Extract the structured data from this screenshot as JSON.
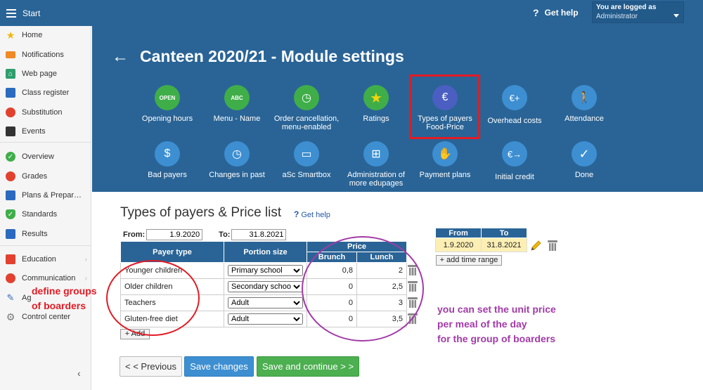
{
  "topbar": {
    "start_label": "Start",
    "help_label": "Get help",
    "user_line1": "You are logged as",
    "user_line2": "Administrator"
  },
  "sidebar": {
    "items": [
      {
        "label": "Home",
        "icon": "star-icon",
        "color": "#f2b705"
      },
      {
        "label": "Notifications",
        "icon": "envelope-icon",
        "color": "#f08a24"
      },
      {
        "label": "Web page",
        "icon": "house-icon",
        "color": "#2e9e6b"
      },
      {
        "label": "Class register",
        "icon": "register-icon",
        "color": "#2a6bbf"
      },
      {
        "label": "Substitution",
        "icon": "person-icon",
        "color": "#e2412f"
      },
      {
        "label": "Events",
        "icon": "calendar-icon",
        "color": "#333333"
      },
      {
        "label": "Overview",
        "icon": "check-circle-icon",
        "color": "#3fae49"
      },
      {
        "label": "Grades",
        "icon": "grades-icon",
        "color": "#e2412f"
      },
      {
        "label": "Plans & Prepar…",
        "icon": "briefcase-icon",
        "color": "#2a6bbf"
      },
      {
        "label": "Standards",
        "icon": "shield-icon",
        "color": "#3fae49"
      },
      {
        "label": "Results",
        "icon": "bar-chart-icon",
        "color": "#2a6bbf"
      },
      {
        "label": "Education",
        "icon": "book-icon",
        "color": "#e2412f"
      },
      {
        "label": "Communication",
        "icon": "chat-icon",
        "color": "#e2412f"
      },
      {
        "label": "Ag",
        "icon": "pen-icon",
        "color": "#2a6bbf"
      },
      {
        "label": "Control center",
        "icon": "gear-icon",
        "color": "#777777"
      }
    ]
  },
  "header": {
    "title": "Canteen 2020/21 - Module settings",
    "tiles": [
      {
        "label": "Opening hours",
        "icon": "open-sign-icon",
        "color": "#3fae49"
      },
      {
        "label": "Menu - Name",
        "icon": "abc-123-icon",
        "color": "#3fae49"
      },
      {
        "label": "Order cancellation, menu-enabled",
        "icon": "clock-icon",
        "color": "#3fae49"
      },
      {
        "label": "Ratings",
        "icon": "star-icon",
        "color": "#3fae49"
      },
      {
        "label": "Types of payers Food-Price",
        "icon": "payer-icon",
        "color": "#4a5fc1"
      },
      {
        "label": "Overhead costs",
        "icon": "euro-plus-icon",
        "color": "#3d8fd1"
      },
      {
        "label": "Attendance",
        "icon": "walking-person-icon",
        "color": "#3d8fd1"
      },
      {
        "label": "Bad payers",
        "icon": "money-bag-icon",
        "color": "#3d8fd1"
      },
      {
        "label": "Changes in past",
        "icon": "history-clock-icon",
        "color": "#3d8fd1"
      },
      {
        "label": "aSc Smartbox",
        "icon": "monitor-icon",
        "color": "#3d8fd1"
      },
      {
        "label": "Administration of more edupages",
        "icon": "org-chart-icon",
        "color": "#3d8fd1"
      },
      {
        "label": "Payment plans",
        "icon": "handshake-icon",
        "color": "#3d8fd1"
      },
      {
        "label": "Initial credit",
        "icon": "euro-arrow-icon",
        "color": "#3d8fd1"
      },
      {
        "label": "Done",
        "icon": "checkmark-icon",
        "color": "#3d8fd1"
      }
    ]
  },
  "content": {
    "title": "Types of payers & Price list",
    "get_help": "Get help",
    "from_label": "From:",
    "from_value": "1.9.2020",
    "to_label": "To:",
    "to_value": "31.8.2021",
    "table": {
      "col_payer": "Payer type",
      "col_portion": "Portion size",
      "col_price": "Price",
      "col_brunch": "Brunch",
      "col_lunch": "Lunch",
      "rows": [
        {
          "payer": "Younger children",
          "portion": "Primary school",
          "brunch": "0,8",
          "lunch": "2"
        },
        {
          "payer": "Older children",
          "portion": "Secondary school",
          "brunch": "0",
          "lunch": "2,5"
        },
        {
          "payer": "Teachers",
          "portion": "Adult",
          "brunch": "0",
          "lunch": "3"
        },
        {
          "payer": "Gluten-free diet",
          "portion": "Adult",
          "brunch": "0",
          "lunch": "3,5"
        }
      ],
      "add_label": "+ Add"
    },
    "ranges": {
      "col_from": "From",
      "col_to": "To",
      "row_from": "1.9.2020",
      "row_to": "31.8.2021",
      "add_label": "+ add time range"
    },
    "buttons": {
      "prev": "< < Previous",
      "save": "Save changes",
      "continue": "Save and continue > >"
    }
  },
  "annotations": {
    "red_line1": "define groups",
    "red_line2": "of boarders",
    "purple_line1": "you can set the unit price",
    "purple_line2": "per meal of the day",
    "purple_line3": "for the group of boarders"
  }
}
